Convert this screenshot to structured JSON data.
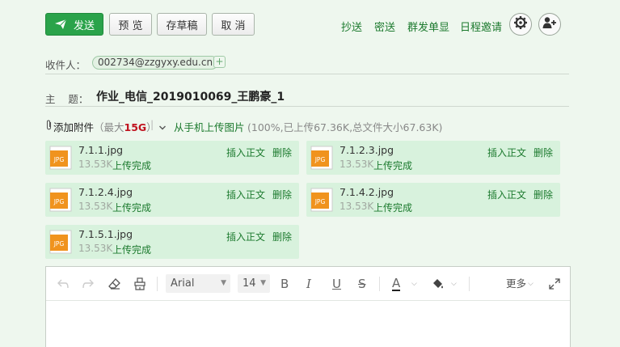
{
  "toolbar": {
    "send": "发送",
    "preview": "预 览",
    "draft": "存草稿",
    "cancel": "取 消",
    "links": [
      "抄送",
      "密送",
      "群发单显",
      "日程邀请"
    ]
  },
  "recipient": {
    "label": "收件人：",
    "address": "002734@zzgyxy.edu.cn",
    "add_symbol": "+"
  },
  "subject": {
    "label": "主    题：",
    "value": "作业_电信_2019010069_王鹏豪_1"
  },
  "attach_bar": {
    "add_label": "添加附件",
    "max_prefix": "（最大",
    "max_value": "15G",
    "max_suffix": "）",
    "phone_upload": "从手机上传图片",
    "summary": "(100%,已上传67.36K,总文件大小67.63K)"
  },
  "attachments": [
    {
      "name": "7.1.1.jpg",
      "size": "13.53K",
      "status": "上传完成",
      "type": "JPG"
    },
    {
      "name": "7.1.2.3.jpg",
      "size": "13.53K",
      "status": "上传完成",
      "type": "JPG"
    },
    {
      "name": "7.1.2.4.jpg",
      "size": "13.53K",
      "status": "上传完成",
      "type": "JPG"
    },
    {
      "name": "7.1.4.2.jpg",
      "size": "13.53K",
      "status": "上传完成",
      "type": "JPG"
    },
    {
      "name": "7.1.5.1.jpg",
      "size": "13.53K",
      "status": "上传完成",
      "type": "JPG"
    }
  ],
  "attachment_actions": {
    "insert": "插入正文",
    "delete": "删除"
  },
  "editor": {
    "font_family": "Arial",
    "font_size": "14",
    "bold": "B",
    "italic": "I",
    "underline": "U",
    "strike": "S",
    "font_color": "A",
    "more": "更多"
  },
  "colors": {
    "accent": "#2aa34a",
    "link": "#1c7a2e",
    "card_bg": "#d8f2dd",
    "file_icon": "#f0931e",
    "max_size": "#c0121e"
  }
}
